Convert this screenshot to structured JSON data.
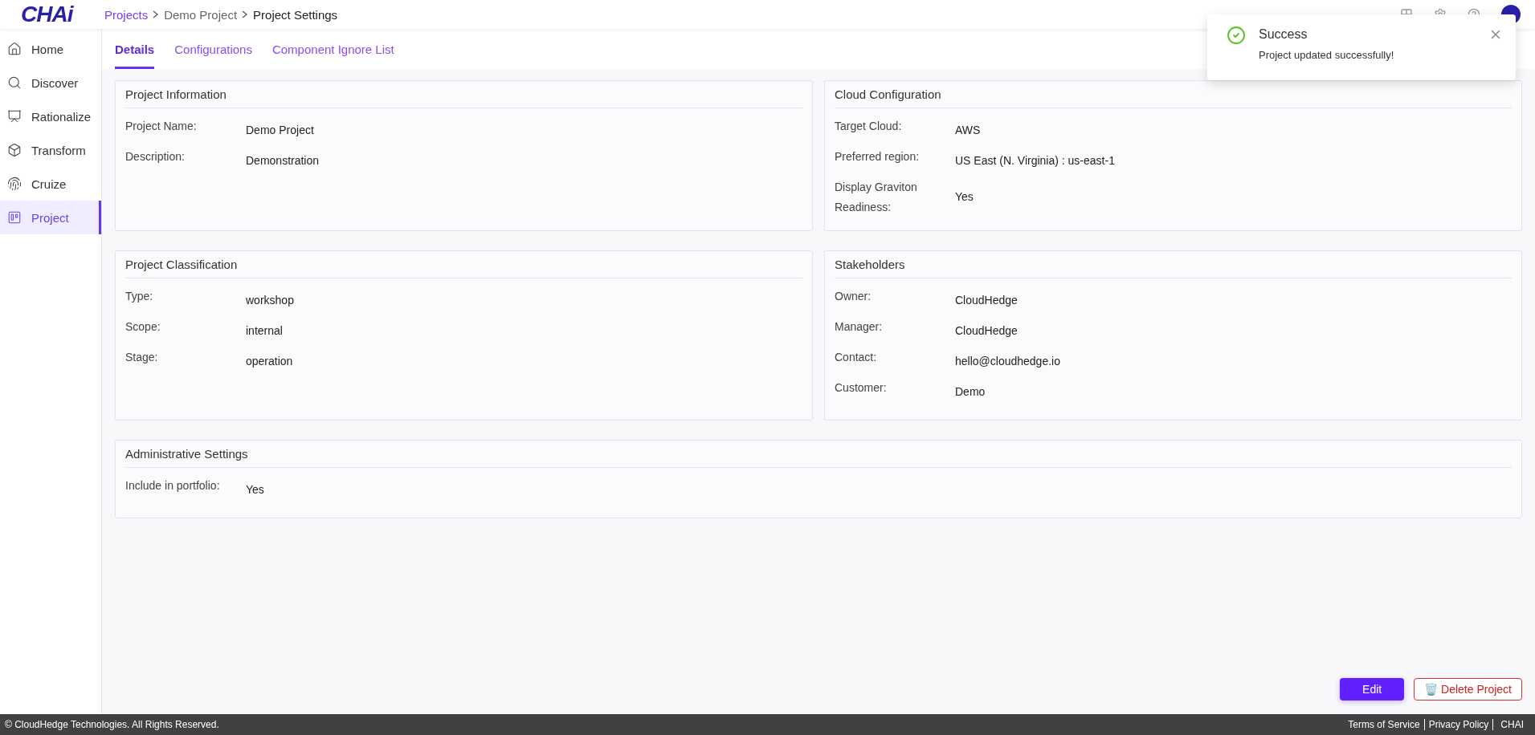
{
  "logo": "CHAi",
  "breadcrumb": [
    {
      "label": "Projects",
      "kind": "link"
    },
    {
      "label": "Demo Project",
      "kind": "plain"
    },
    {
      "label": "Project Settings",
      "kind": "current"
    }
  ],
  "sidebar": {
    "items": [
      {
        "label": "Home",
        "selected": false
      },
      {
        "label": "Discover",
        "selected": false
      },
      {
        "label": "Rationalize",
        "selected": false
      },
      {
        "label": "Transform",
        "selected": false
      },
      {
        "label": "Cruize",
        "selected": false
      },
      {
        "label": "Project",
        "selected": true
      }
    ]
  },
  "tabs": [
    {
      "label": "Details",
      "selected": true
    },
    {
      "label": "Configurations",
      "selected": false
    },
    {
      "label": "Component Ignore List",
      "selected": false
    }
  ],
  "cards": [
    {
      "title": "Project Information",
      "fields": [
        {
          "label": "Project Name:",
          "value": "Demo Project"
        },
        {
          "label": "Description:",
          "value": "Demonstration"
        }
      ]
    },
    {
      "title": "Cloud Configuration",
      "fields": [
        {
          "label": "Target Cloud:",
          "value": "AWS"
        },
        {
          "label": "Preferred region:",
          "value": "US East (N. Virginia) : us-east-1"
        },
        {
          "label": "Display Graviton Readiness:",
          "value": "Yes"
        }
      ]
    },
    {
      "title": "Project Classification",
      "fields": [
        {
          "label": "Type:",
          "value": "workshop"
        },
        {
          "label": "Scope:",
          "value": "internal"
        },
        {
          "label": "Stage:",
          "value": "operation"
        }
      ]
    },
    {
      "title": "Stakeholders",
      "fields": [
        {
          "label": "Owner:",
          "value": "CloudHedge"
        },
        {
          "label": "Manager:",
          "value": "CloudHedge"
        },
        {
          "label": "Contact:",
          "value": "hello@cloudhedge.io"
        },
        {
          "label": "Customer:",
          "value": "Demo"
        }
      ]
    },
    {
      "title": "Administrative Settings",
      "fields": [
        {
          "label": "Include in portfolio:",
          "value": "Yes"
        }
      ]
    }
  ],
  "actions": [
    {
      "label": "Edit",
      "kind": "primary"
    },
    {
      "label": "Delete Project",
      "kind": "danger",
      "emoji": "🗑️"
    }
  ],
  "toast": {
    "title": "Success",
    "message": "Project updated successfully!"
  },
  "footer": {
    "copyright": "© CloudHedge Technologies. All Rights Reserved.",
    "links": [
      "Terms of Service",
      "Privacy Policy",
      "CHAI"
    ]
  }
}
